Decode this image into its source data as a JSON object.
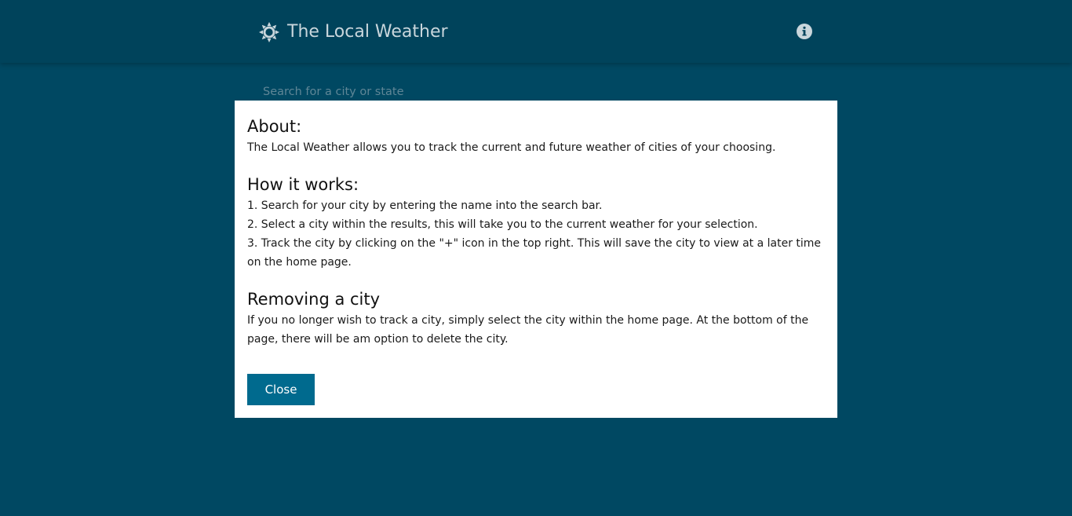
{
  "header": {
    "title": "The Local Weather",
    "brand_icon": "sun-icon",
    "info_icon": "info-icon"
  },
  "search": {
    "placeholder": "Search for a city or state",
    "value": ""
  },
  "modal": {
    "about": {
      "heading": "About:",
      "text": "The Local Weather allows you to track the current and future weather of cities of your choosing."
    },
    "how": {
      "heading": "How it works:",
      "steps": [
        "1. Search for your city by entering the name into the search bar.",
        "2. Select a city within the results, this will take you to the current weather for your selection.",
        "3. Track the city by clicking on the \"+\" icon in the top right. This will save the city to view at a later time on the home page."
      ]
    },
    "removing": {
      "heading": "Removing a city",
      "text": "If you no longer wish to track a city, simply select the city within the home page. At the bottom of the page, there will be am option to delete the city."
    },
    "close_label": "Close"
  },
  "colors": {
    "background": "#004862",
    "header": "#00435b",
    "button": "#006a8e",
    "modal": "#ffffff"
  }
}
